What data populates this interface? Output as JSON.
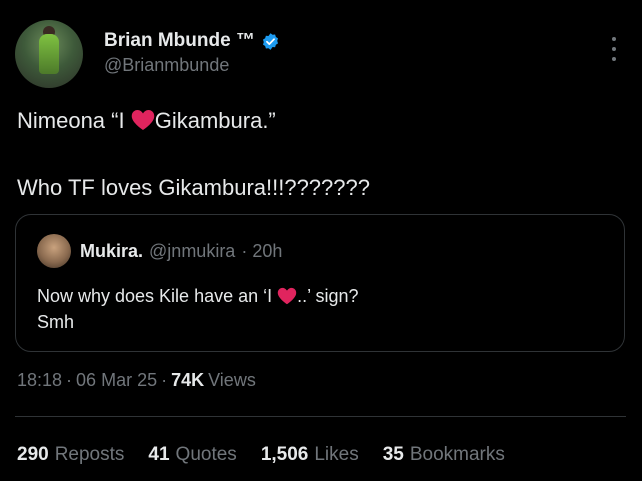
{
  "author": {
    "name": "Brian Mbunde ™",
    "handle": "@Brianmbunde",
    "verified_color": "#1d9bf0"
  },
  "tweet": {
    "line1_before": "Nimeona “I ",
    "line1_after": "Gikambura.”",
    "line2": "Who TF loves Gikambura!!!???????"
  },
  "quoted": {
    "name": "Mukira.",
    "handle": "@jnmukira",
    "time": "· 20h",
    "line1_before": "Now why does Kile have an ‘I ",
    "line1_after": "..’ sign?",
    "line2": "Smh"
  },
  "meta": {
    "time": "18:18",
    "sep1": "·",
    "date": "06 Mar 25",
    "sep2": "·",
    "views": "74K",
    "views_label": "Views"
  },
  "stats": [
    {
      "count": "290",
      "label": "Reposts"
    },
    {
      "count": "41",
      "label": "Quotes"
    },
    {
      "count": "1,506",
      "label": "Likes"
    },
    {
      "count": "35",
      "label": "Bookmarks"
    }
  ]
}
